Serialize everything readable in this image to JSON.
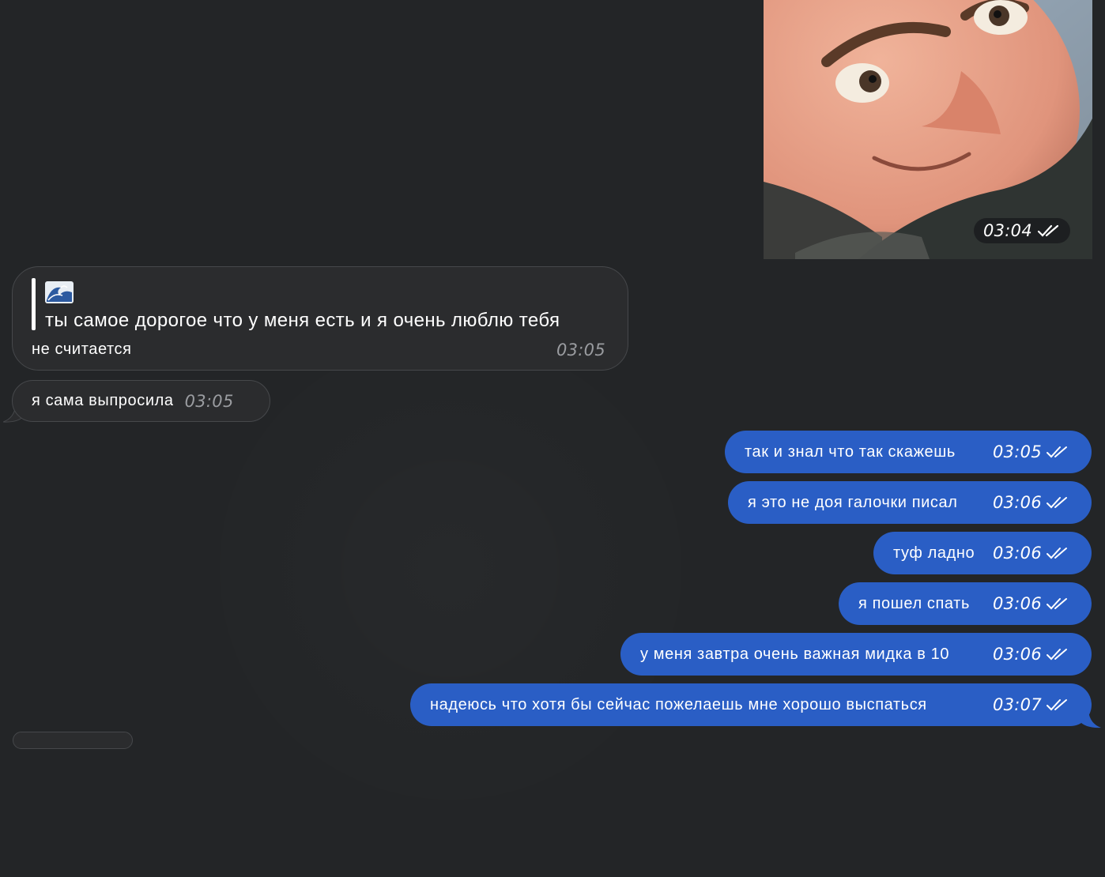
{
  "photo_message": {
    "time": "03:04",
    "status_icon": "double-check-icon"
  },
  "reply_message": {
    "quoted_emoji": "🌊",
    "quoted_text": "ты самое дорогое что у меня есть и я очень люблю тебя",
    "text": "не считается",
    "time": "03:05"
  },
  "incoming_message": {
    "text": "я сама выпросила",
    "time": "03:05"
  },
  "outgoing_messages": [
    {
      "text": "так и знал что так скажешь",
      "time": "03:05"
    },
    {
      "text": "я это не доя галочки писал",
      "time": "03:06"
    },
    {
      "text": "туф ладно",
      "time": "03:06"
    },
    {
      "text": "я пошел спать",
      "time": "03:06"
    },
    {
      "text": "у меня завтра очень важная мидка в 10",
      "time": "03:06"
    },
    {
      "text": "надеюсь что хотя бы сейчас пожелаешь мне хорошо выспаться",
      "time": "03:07"
    }
  ],
  "colors": {
    "background": "#232527",
    "outgoing_bubble": "#2a5ec5",
    "incoming_bubble": "#2b2c2e"
  }
}
